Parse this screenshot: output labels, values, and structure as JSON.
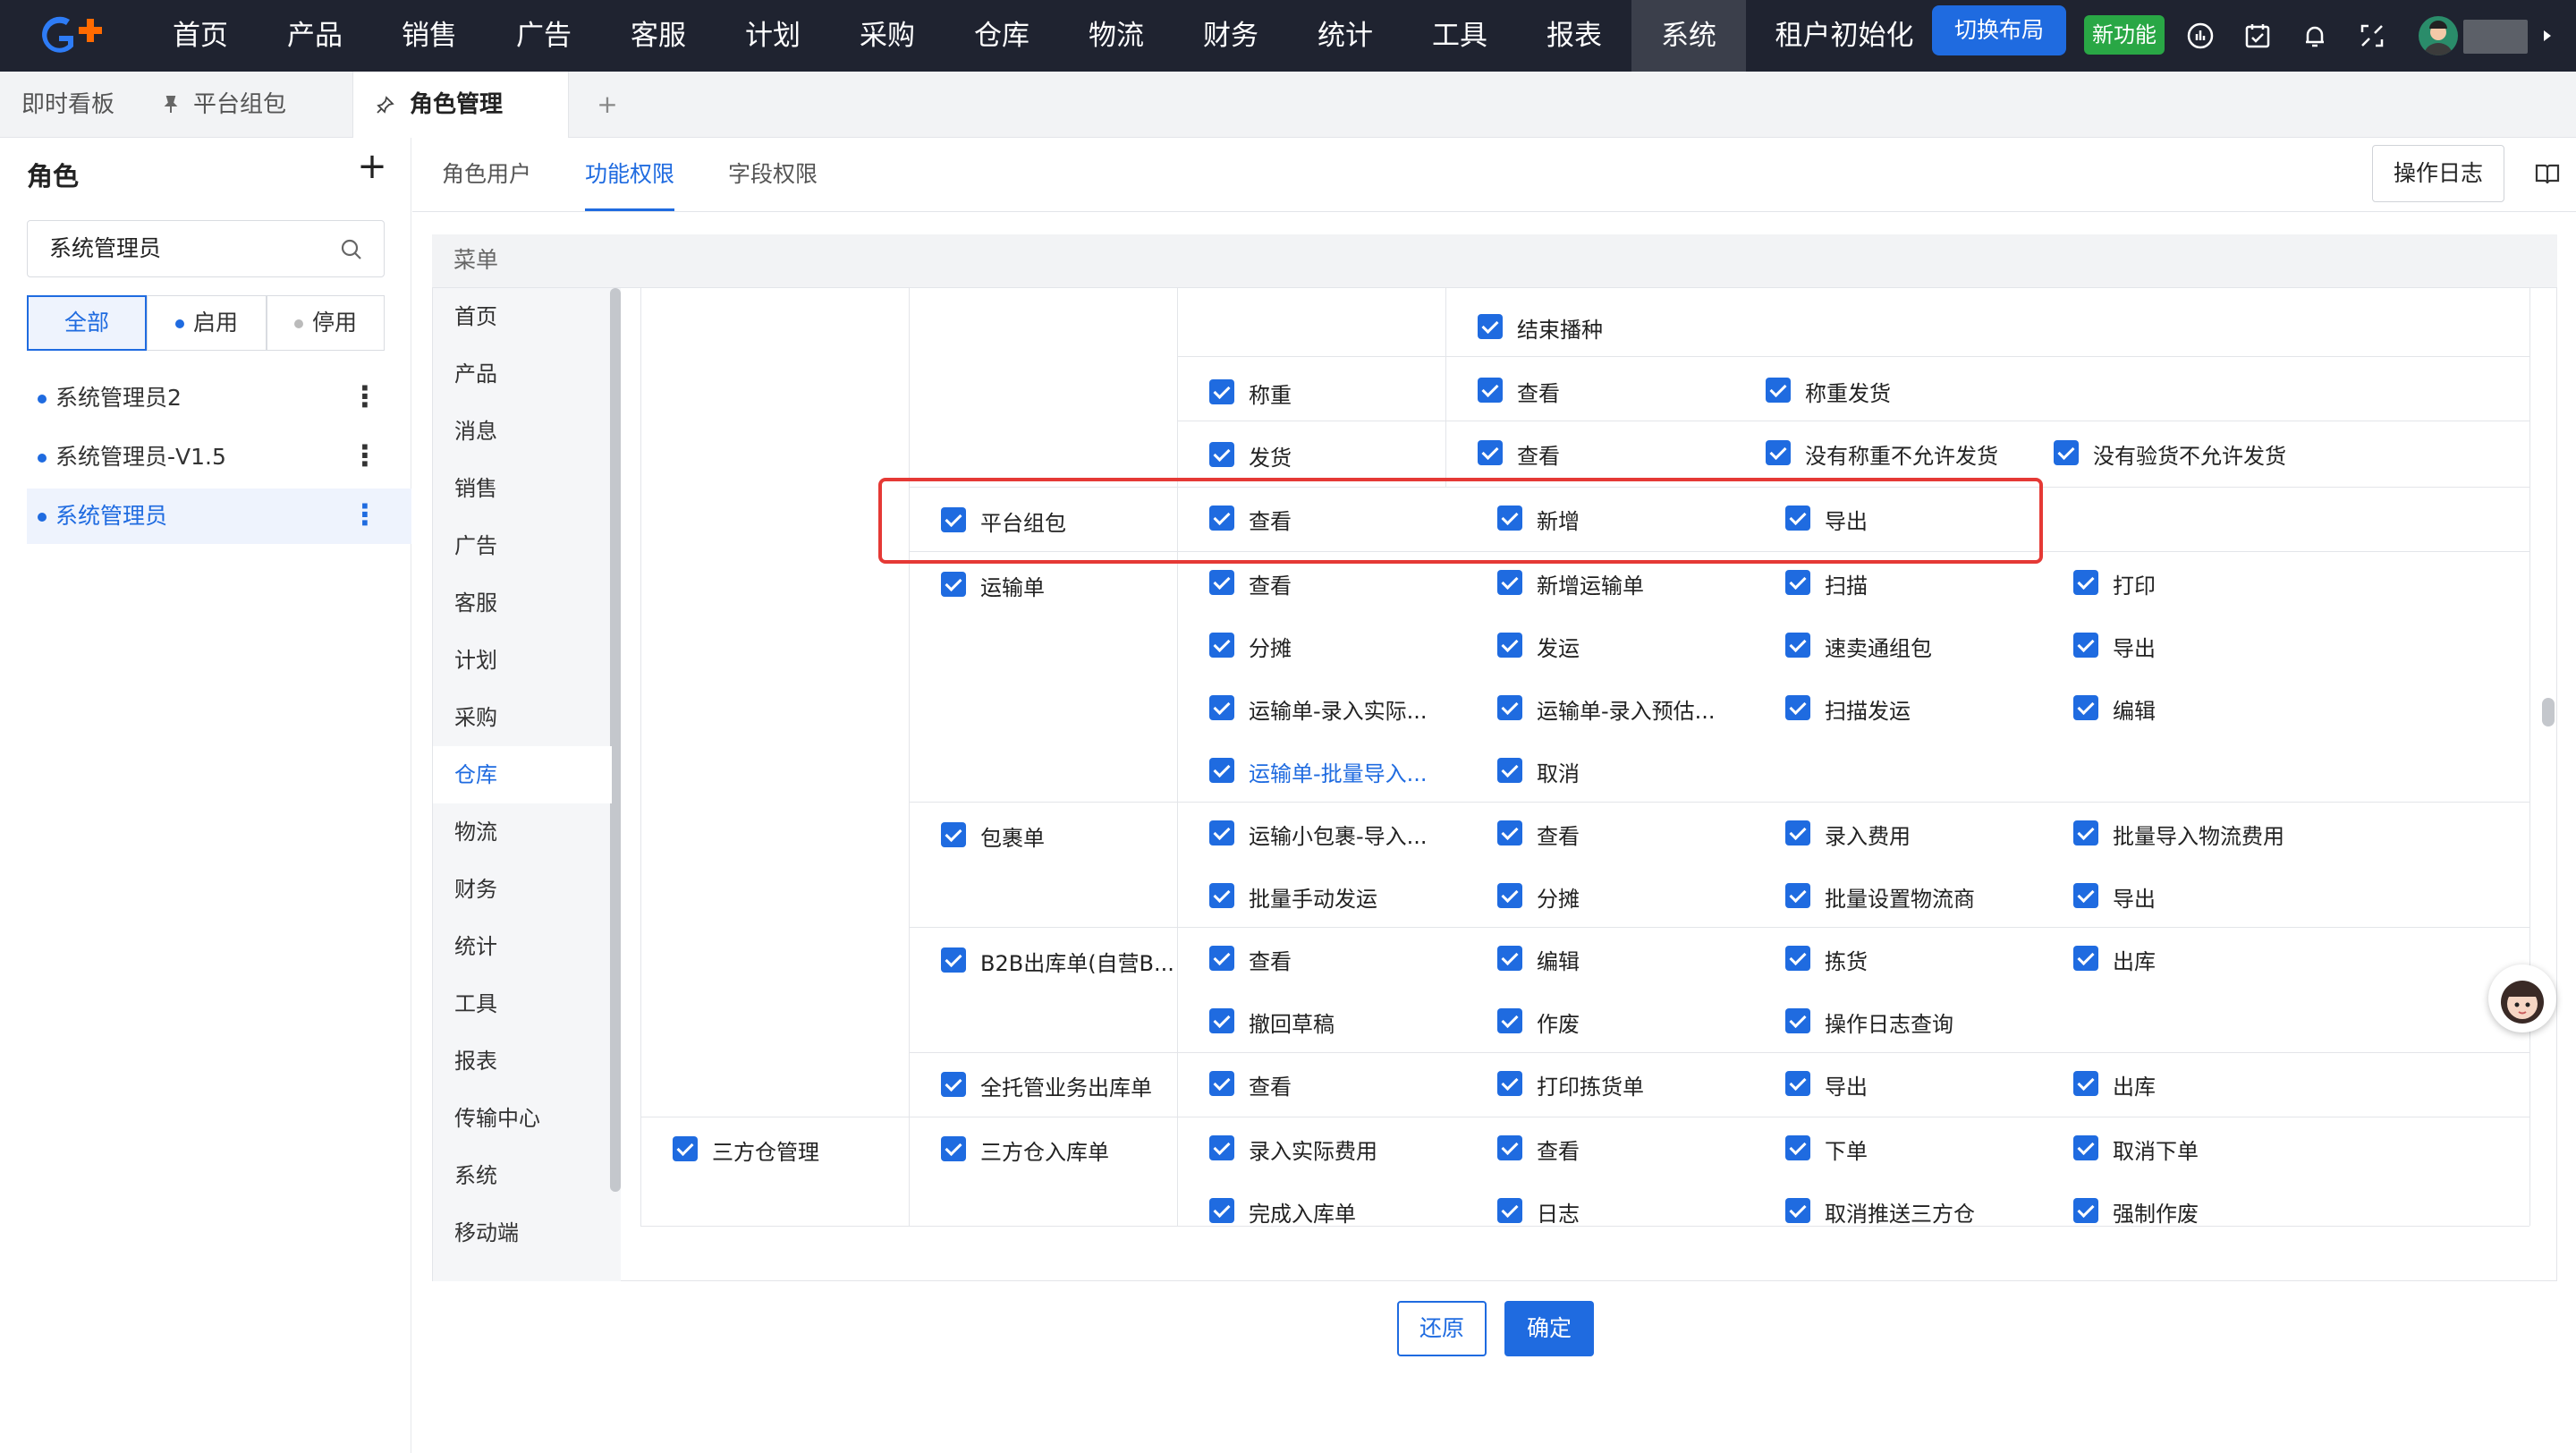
{
  "nav": [
    "首页",
    "产品",
    "销售",
    "广告",
    "客服",
    "计划",
    "采购",
    "仓库",
    "物流",
    "财务",
    "统计",
    "工具",
    "报表",
    "系统",
    "租户初始化"
  ],
  "nav_active": "系统",
  "switch_layout": "切换布局",
  "new_feature": "新功能",
  "tabs": [
    "即时看板",
    "平台组包",
    "角色管理"
  ],
  "tab_add": "+",
  "sidebar": {
    "title": "角色",
    "add": "+",
    "search_value": "系统管理员",
    "filters": [
      "全部",
      "启用",
      "停用"
    ],
    "roles": [
      "系统管理员2",
      "系统管理员-V1.5",
      "系统管理员"
    ]
  },
  "subtabs": [
    "角色用户",
    "功能权限",
    "字段权限"
  ],
  "op_log": "操作日志",
  "panel": {
    "header": "菜单"
  },
  "menu": [
    "首页",
    "产品",
    "消息",
    "销售",
    "广告",
    "客服",
    "计划",
    "采购",
    "仓库",
    "物流",
    "财务",
    "统计",
    "工具",
    "报表",
    "传输中心",
    "系统",
    "移动端"
  ],
  "menu_active": "仓库",
  "perm": {
    "l2": [
      "平台组包",
      "运输单",
      "包裹单",
      "B2B出库单(自营B...",
      "全托管业务出库单",
      "三方仓入库单"
    ],
    "l1": [
      "三方仓管理"
    ],
    "l3": [
      "称重",
      "发货"
    ],
    "actions": [
      "结束播种",
      "查看",
      "称重发货",
      "查看",
      "没有称重不允许发货",
      "没有验货不允许发货",
      "查看",
      "新增",
      "导出",
      "查看",
      "新增运输单",
      "扫描",
      "打印",
      "分摊",
      "发运",
      "速卖通组包",
      "导出",
      "运输单-录入实际...",
      "运输单-录入预估...",
      "扫描发运",
      "编辑",
      "运输单-批量导入...",
      "取消",
      "运输小包裹-导入...",
      "查看",
      "录入费用",
      "批量导入物流费用",
      "批量手动发运",
      "分摊",
      "批量设置物流商",
      "导出",
      "查看",
      "编辑",
      "拣货",
      "出库",
      "撤回草稿",
      "作废",
      "操作日志查询",
      "查看",
      "打印拣货单",
      "导出",
      "出库",
      "录入实际费用",
      "查看",
      "下单",
      "取消下单",
      "完成入库单",
      "日志",
      "取消推送三方仓",
      "强制作废"
    ]
  },
  "buttons": {
    "reset": "还原",
    "confirm": "确定"
  },
  "colors": {
    "primary": "#1f6be0",
    "highlight": "#e53935",
    "topbar": "#1f2330"
  }
}
